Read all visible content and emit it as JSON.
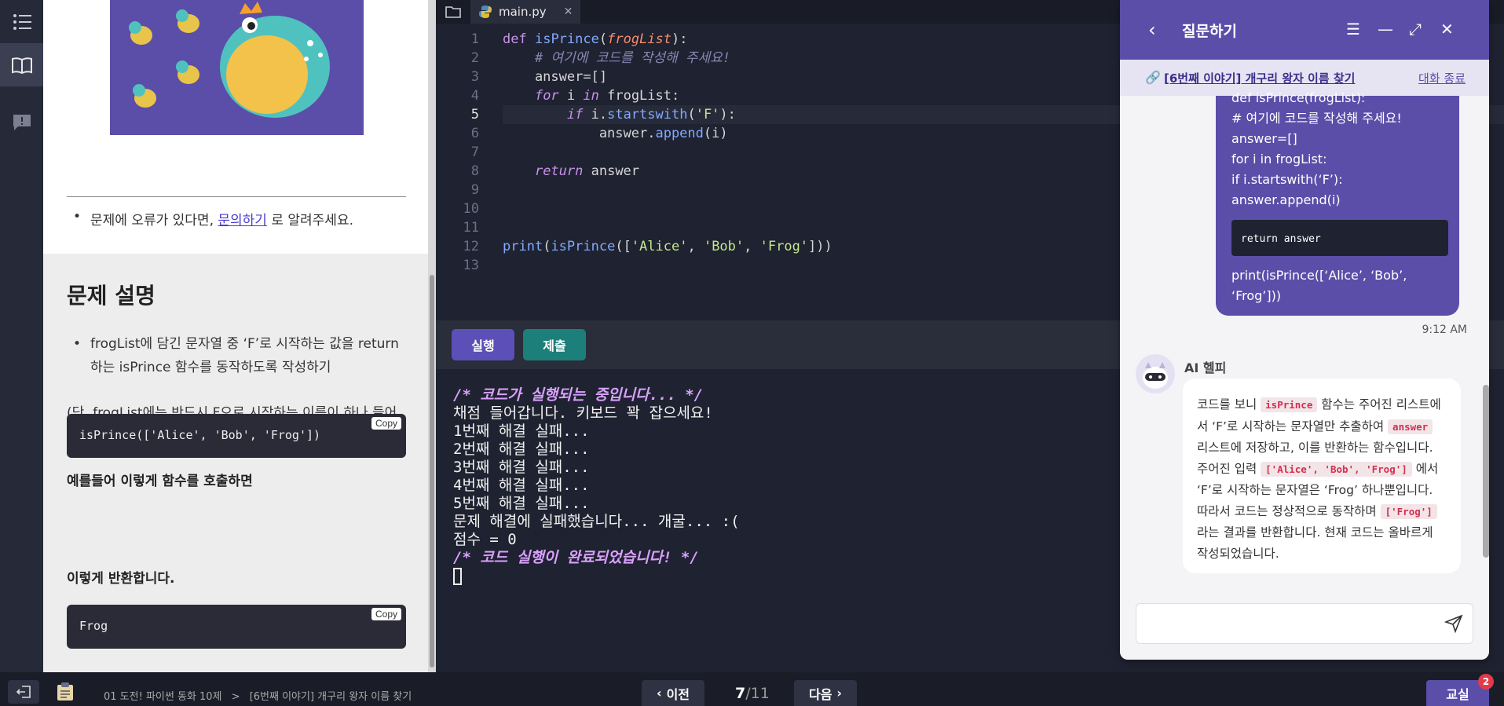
{
  "rail": {
    "tooltip": "목록"
  },
  "problem": {
    "notice_prefix": "문제에 오류가 있다면, ",
    "notice_link": "문의하기",
    "notice_suffix": " 로 알려주세요.",
    "section_title": "문제 설명",
    "bullet": "frogList에 담긴 문자열 중 ‘F’로 시작하는 값을 return 하는 isPrince 함수를 동작하도록 작성하기",
    "note": "(단, frogList에는 반드시 F으로 시작하는 이름이 하나 들어있습니다.)",
    "example_call_label": "예를들어 이렇게 함수를 호출하면",
    "example_call_code": "isPrince(['Alice', 'Bob', 'Frog'])",
    "return_label": "이렇게 반환합니다.",
    "return_code": "Frog",
    "copy_label": "Copy"
  },
  "editor": {
    "tab_name": "main.py",
    "current_line": 5,
    "line_numbers": [
      "1",
      "2",
      "3",
      "4",
      "5",
      "6",
      "7",
      "8",
      "9",
      "10",
      "11",
      "12",
      "13"
    ],
    "code_lines": [
      "def isPrince(frogList):",
      "    # 여기에 코드를 작성해 주세요!",
      "    answer=[]",
      "    for i in frogList:",
      "        if i.startswith('F'):",
      "            answer.append(i)",
      "",
      "    return answer",
      "",
      "",
      "",
      "print(isPrince(['Alice', 'Bob', 'Frog']))",
      ""
    ]
  },
  "actions": {
    "run": "실행",
    "submit": "제출"
  },
  "console": {
    "lines": [
      "/* 코드가 실행되는 중입니다... */",
      "채점 들어갑니다. 키보드 꽉 잡으세요!",
      "1번째 해결 실패...",
      "2번째 해결 실패...",
      "3번째 해결 실패...",
      "4번째 해결 실패...",
      "5번째 해결 실패...",
      "문제 해결에 실패했습니다... 개굴... :(",
      "점수 = 0",
      "/* 코드 실행이 완료되었습니다! */"
    ]
  },
  "chat": {
    "title": "질문하기",
    "topic_link": "[6번째 이야기] 개구리 왕자 이름 찾기",
    "end_label": "대화 종료",
    "user_message_lines": [
      "def isPrince(frogList):",
      "# 여기에 코드를 작성해 주세요!",
      "answer=[]",
      "for i in frogList:",
      "if i.startswith(‘F’):",
      "answer.append(i)"
    ],
    "user_message_code": "return answer",
    "user_message_tail": "print(isPrince([‘Alice’, ‘Bob’, ‘Frog’]))",
    "time": "9:12 AM",
    "ai_name": "AI 헬피",
    "ai_message": {
      "t1": "코드를 보니 ",
      "c1": "isPrince",
      "t2": " 함수는 주어진 리스트에서 ‘F’로 시작하는 문자열만 추출하여 ",
      "c2": "answer",
      "t3": " 리스트에 저장하고, 이를 반환하는 함수입니다. 주어진 입력 ",
      "c3": "['Alice', 'Bob', 'Frog']",
      "t4": " 에서 ‘F’로 시작하는 문자열은 ‘Frog’ 하나뿐입니다. 따라서 코드는 정상적으로 동작하며 ",
      "c4": "['Frog']",
      "t5": " 라는 결과를 반환합니다. 현재 코드는 올바르게 작성되었습니다."
    },
    "input_placeholder": ""
  },
  "bottom": {
    "breadcrumb_course": "01 도전! 파이썬 동화 10제",
    "breadcrumb_sep": ">",
    "breadcrumb_lesson": "[6번째 이야기] 개구리 왕자 이름 찾기",
    "prev": "이전",
    "next": "다음",
    "page_current": "7",
    "page_total": "/11",
    "classroom": "교실",
    "badge": "2"
  },
  "colors": {
    "accent": "#5b4ea8",
    "submit": "#1c7f7a",
    "editor_bg": "#1f2230",
    "badge": "#e23a4a"
  }
}
